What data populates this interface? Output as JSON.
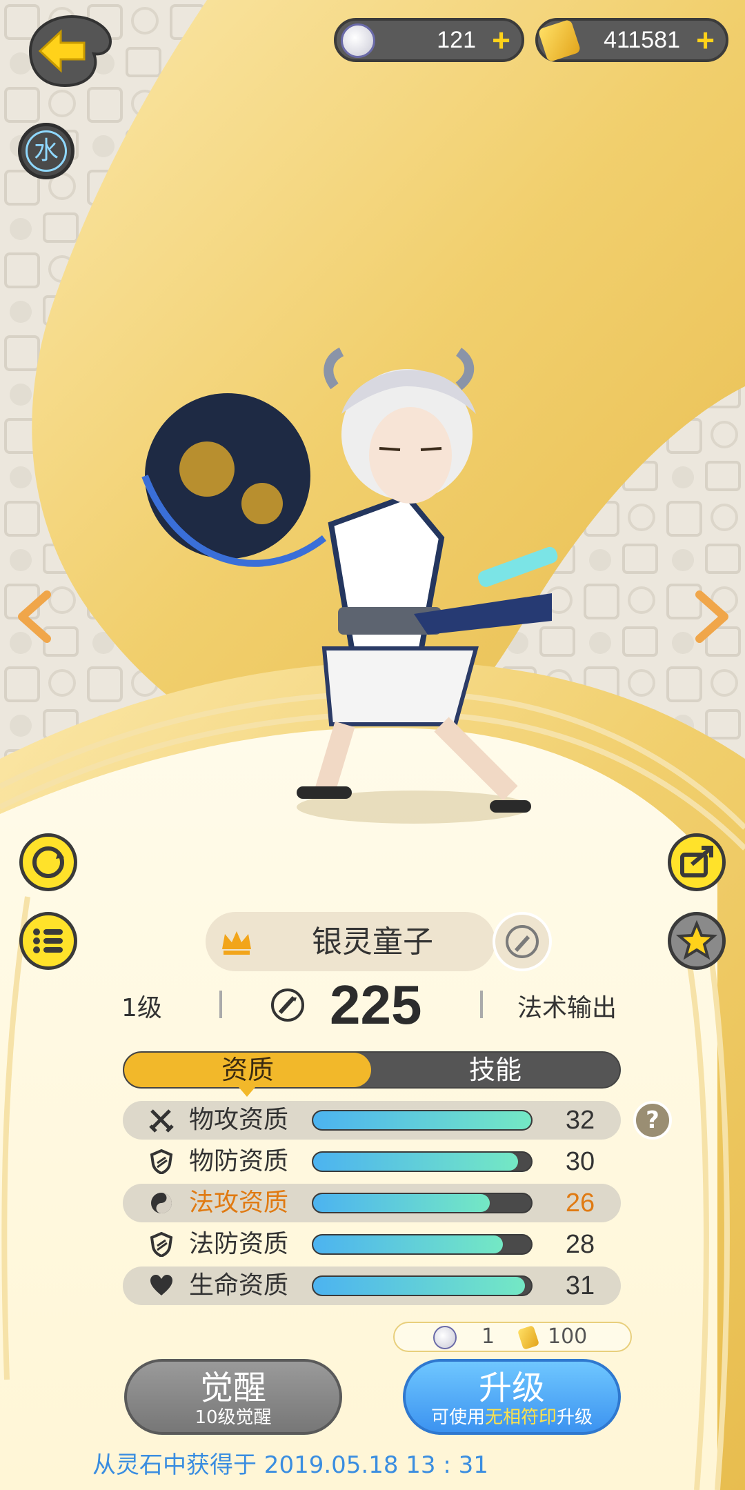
{
  "currency": {
    "tokens": "121",
    "gold": "411581"
  },
  "element_badge": "水",
  "character": {
    "name": "银灵童子",
    "level": "1级",
    "power": "225",
    "role": "法术输出"
  },
  "tabs": [
    {
      "label": "资质",
      "active": true
    },
    {
      "label": "技能",
      "active": false
    }
  ],
  "stats": [
    {
      "label": "物攻资质",
      "value": "32",
      "fill": 1.0,
      "icon": "crossed-swords-icon",
      "shaded": true,
      "highlight": false
    },
    {
      "label": "物防资质",
      "value": "30",
      "fill": 0.94,
      "icon": "shield-icon",
      "shaded": false,
      "highlight": false
    },
    {
      "label": "法攻资质",
      "value": "26",
      "fill": 0.81,
      "icon": "yin-yang-icon",
      "shaded": true,
      "highlight": true
    },
    {
      "label": "法防资质",
      "value": "28",
      "fill": 0.87,
      "icon": "shield-icon",
      "shaded": false,
      "highlight": false
    },
    {
      "label": "生命资质",
      "value": "31",
      "fill": 0.97,
      "icon": "heart-icon",
      "shaded": true,
      "highlight": false
    }
  ],
  "cost": {
    "item1": "1",
    "item2": "100"
  },
  "buttons": {
    "awaken": {
      "label": "觉醒",
      "sub": "10级觉醒"
    },
    "upgrade": {
      "label": "升级",
      "sub_prefix": "可使用",
      "sub_highlight": "无相符印",
      "sub_suffix": "升级"
    }
  },
  "footer": "从灵石中获得于 2019.05.18   13 : 31",
  "colors": {
    "accent_yellow": "#f2b82a",
    "bar_start": "#4cb3f0",
    "bar_end": "#74e8c4",
    "highlight_orange": "#e07a12",
    "footer_blue": "#3a8de0"
  }
}
